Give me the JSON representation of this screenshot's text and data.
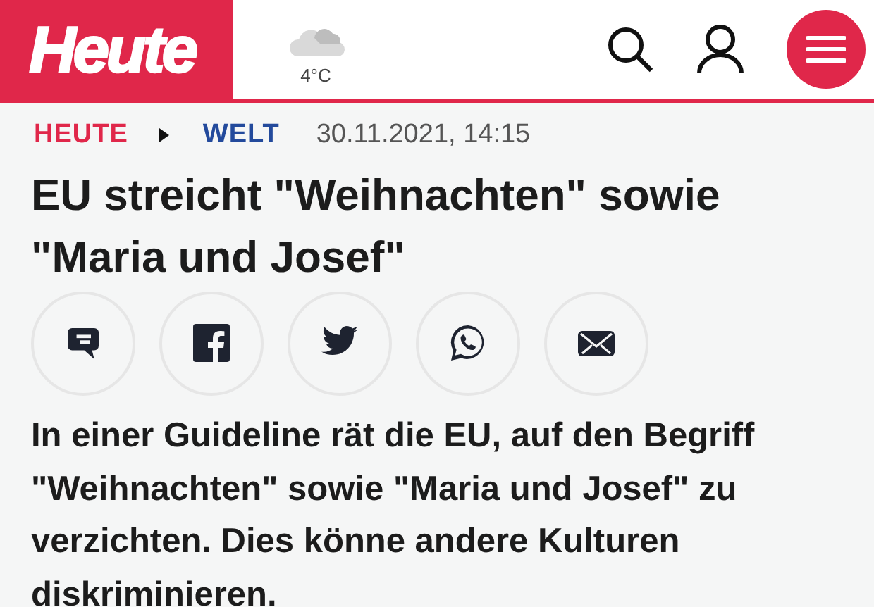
{
  "header": {
    "logo": "Heute",
    "weather": {
      "temperature": "4°C"
    }
  },
  "breadcrumb": [
    {
      "label": "HEUTE",
      "color": "#e0274a"
    },
    {
      "label": "WELT",
      "color": "#234a9c"
    }
  ],
  "date": "30.11.2021, 14:15",
  "headline": "EU streicht \"Weihnachten\" sowie \"Maria und Josef\"",
  "lead": "In einer Guideline rät die EU, auf den Begriff \"Weihnachten\" sowie \"Maria und Josef\" zu verzichten. Dies könne andere Kulturen diskriminieren."
}
